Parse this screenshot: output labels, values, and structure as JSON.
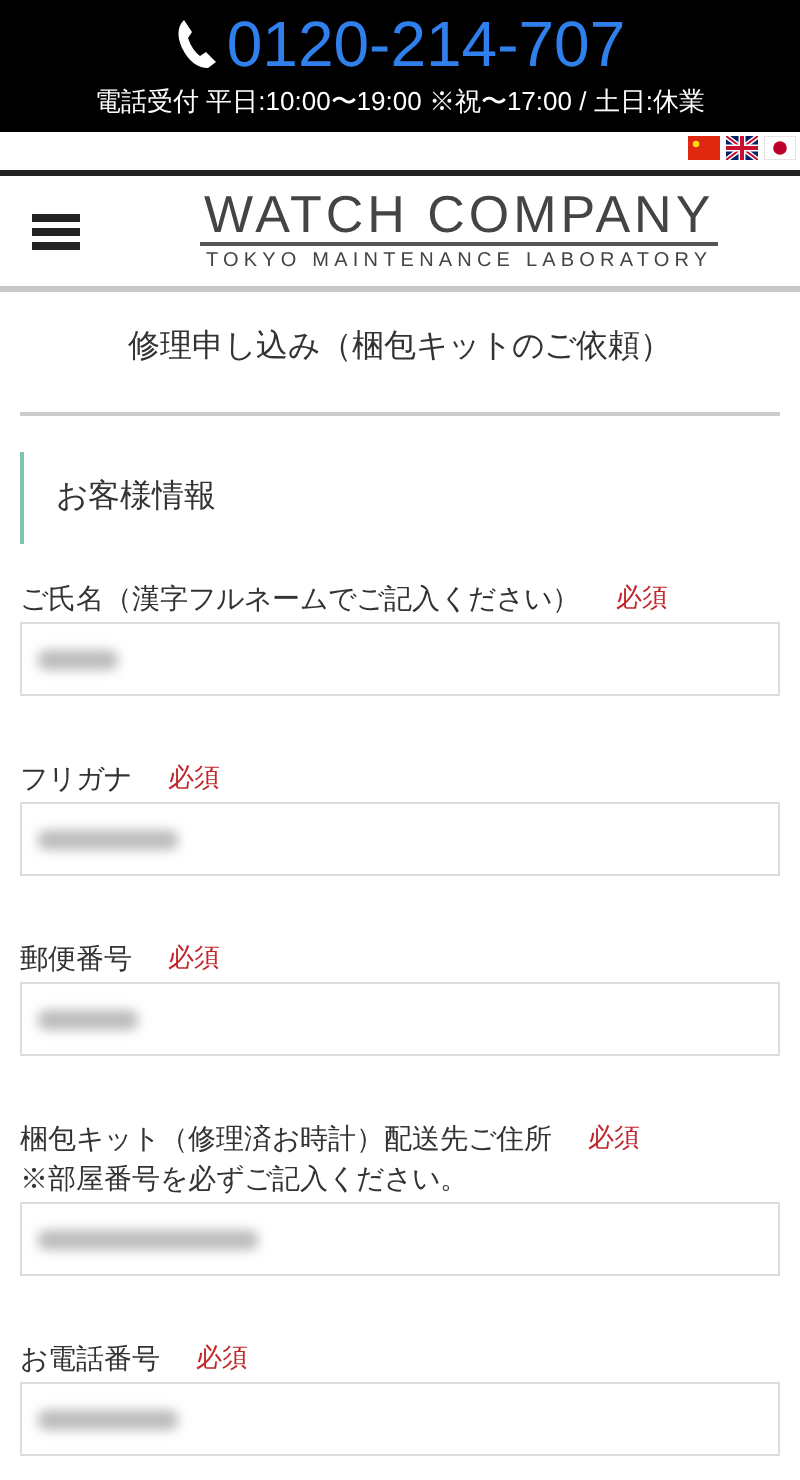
{
  "header": {
    "phone": "0120-214-707",
    "hours": "電話受付 平日:10:00〜19:00 ※祝〜17:00 / 土日:休業"
  },
  "logo": {
    "title": "WATCH COMPANY",
    "subtitle": "TOKYO MAINTENANCE LABORATORY"
  },
  "page_title": "修理申し込み（梱包キットのご依頼）",
  "section_title": "お客様情報",
  "fields": [
    {
      "label": "ご氏名（漢字フルネームでご記入ください）",
      "required": true,
      "required_label": "必須"
    },
    {
      "label": "フリガナ",
      "required": true,
      "required_label": "必須"
    },
    {
      "label": "郵便番号",
      "required": true,
      "required_label": "必須"
    },
    {
      "label": "梱包キット（修理済お時計）配送先ご住所",
      "note": "※部屋番号を必ずご記入ください。",
      "required": true,
      "required_label": "必須"
    },
    {
      "label": "お電話番号",
      "required": true,
      "required_label": "必須"
    }
  ]
}
